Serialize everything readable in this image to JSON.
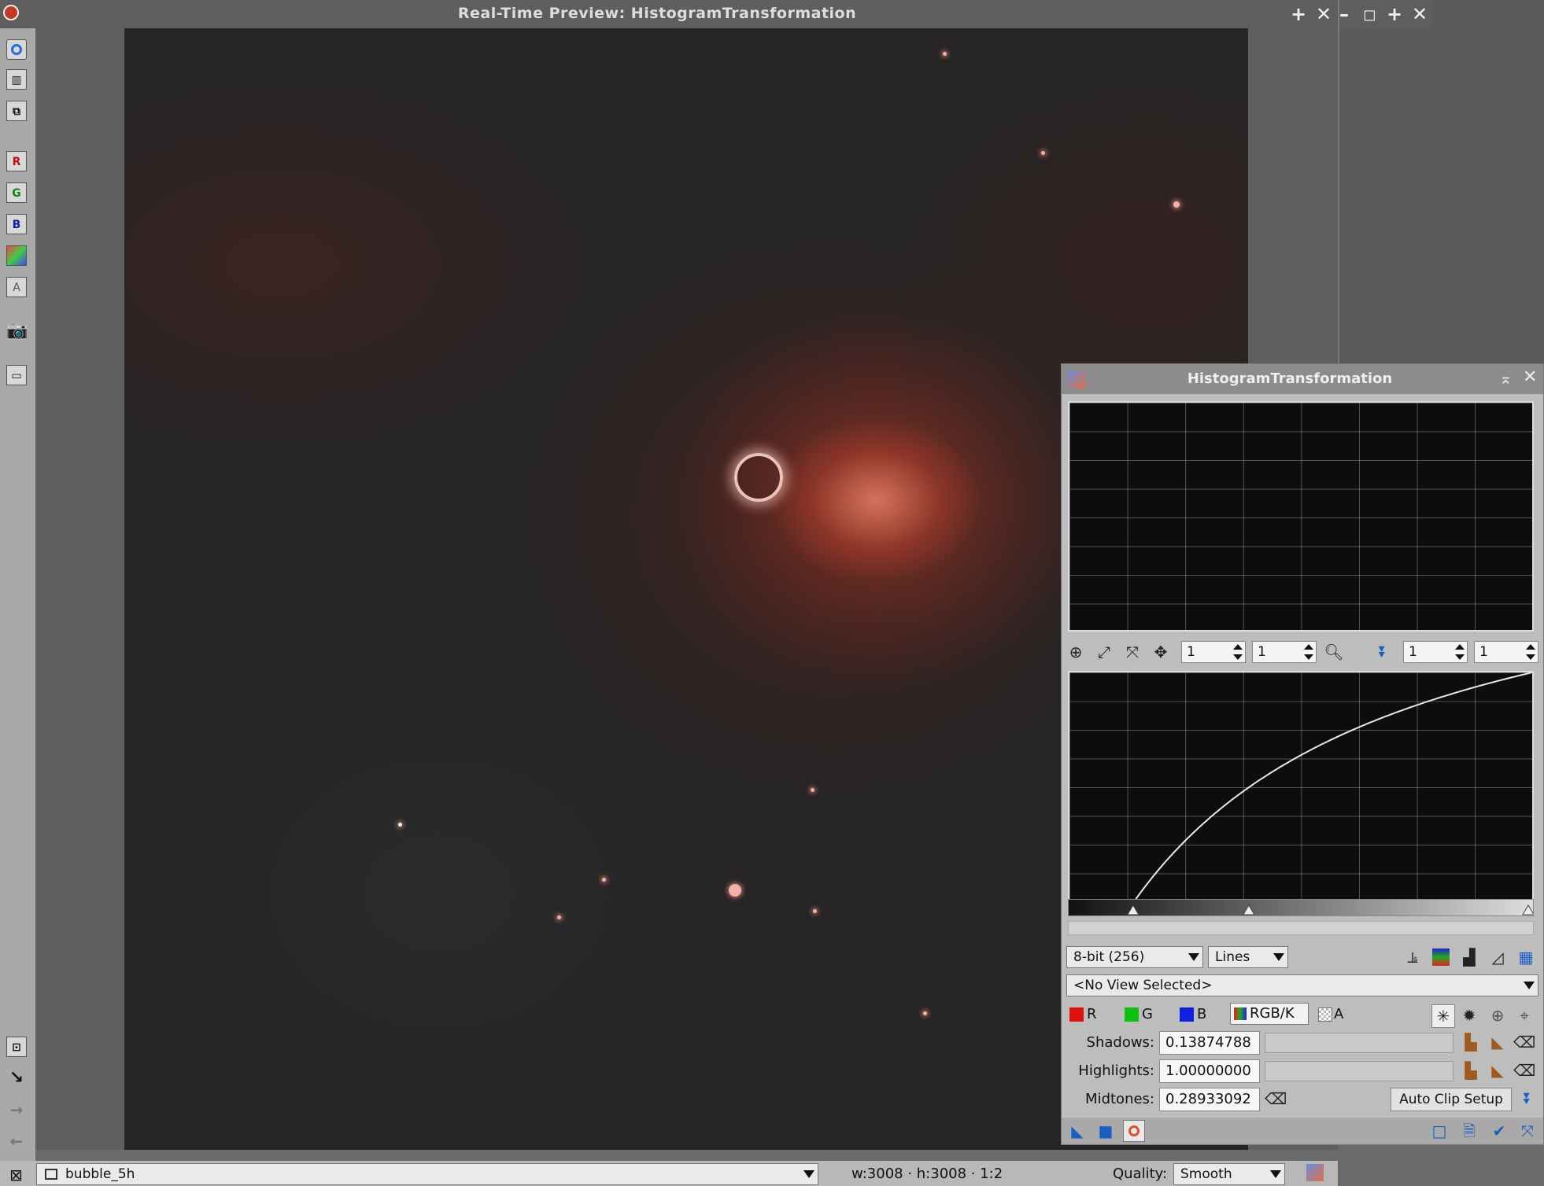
{
  "window": {
    "title": "Real-Time Preview: HistogramTransformation",
    "controls": [
      "+",
      "✕",
      "–",
      "◻",
      "+",
      "✕"
    ]
  },
  "left_toolbar": {
    "letters": {
      "r": "R",
      "g": "G",
      "b": "B",
      "a": "A"
    }
  },
  "status_bar": {
    "view_name": "bubble_5h",
    "dimensions": "w:3008 · h:3008 · 1:2",
    "quality_label": "Quality:",
    "quality_value": "Smooth"
  },
  "histogram_panel": {
    "title": "HistogramTransformation",
    "zoom": {
      "h1": "1",
      "v1": "1",
      "h2": "1",
      "v2": "1"
    },
    "resolution": "8-bit (256)",
    "graph_style": "Lines",
    "view_selector": "<No View Selected>",
    "channels": {
      "r": "R",
      "g": "G",
      "b": "B",
      "rgbk": "RGB/K",
      "a": "A"
    },
    "shadows_label": "Shadows:",
    "shadows_value": "0.13874788",
    "highlights_label": "Highlights:",
    "highlights_value": "1.00000000",
    "midtones_label": "Midtones:",
    "midtones_value": "0.28933092",
    "auto_clip_label": "Auto Clip Setup"
  },
  "transfer_curve": {
    "shadows": 0.13874788,
    "highlights": 1.0,
    "midtones": 0.28933092
  },
  "colors": {
    "red_channel": "#e01010",
    "green_channel": "#10c010",
    "blue_channel": "#1020e0",
    "accent": "#1a5fc0"
  }
}
